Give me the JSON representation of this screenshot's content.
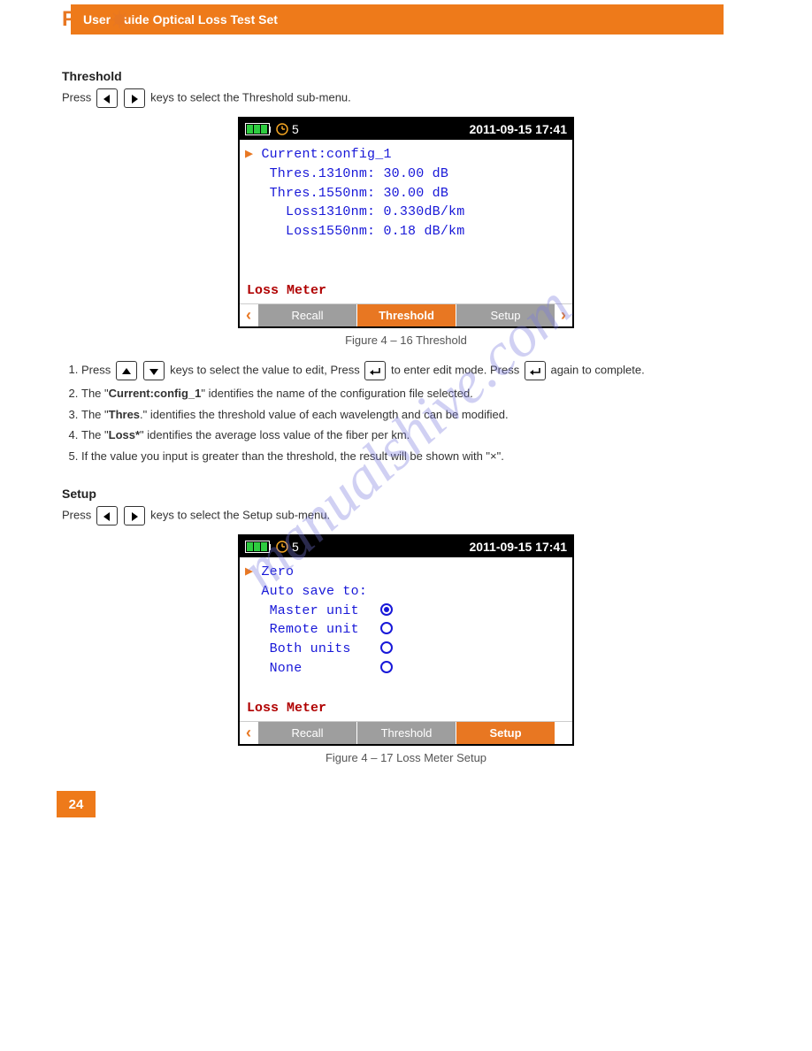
{
  "header": {
    "brand": "PRO",
    "band_text": "User Guide Optical Loss Test Set"
  },
  "watermark": "manualshive.com",
  "section_threshold": {
    "title": "Threshold",
    "intro_prefix": "Press",
    "intro_text": "keys to select the Threshold sub-menu.",
    "ds": {
      "timer": "5",
      "datetime": "2011-09-15 17:41",
      "lines": {
        "current": "Current:config_1",
        "thres1310_label": "Thres.1310nm:",
        "thres1310_value": "30.00 dB",
        "thres1550_label": "Thres.1550nm:",
        "thres1550_value": "30.00 dB",
        "loss1310_label": "Loss1310nm:",
        "loss1310_value": "0.330dB/km",
        "loss1550_label": "Loss1550nm:",
        "loss1550_value": "0.18 dB/km"
      },
      "footer": "Loss Meter",
      "tabs": {
        "recall": "Recall",
        "threshold": "Threshold",
        "setup": "Setup"
      }
    },
    "figcaption": "Figure 4 – 16 Threshold",
    "steps": {
      "s1_a": "Press",
      "s1_b": "keys to select the value to edit, Press",
      "s1_c": "to enter edit mode. Press",
      "s1_d": "again to complete.",
      "s2_a": "The \"",
      "s2_b": "Current:config_1",
      "s2_c": "\" identifies the name of the configuration file selected.",
      "s3_a": "The \"",
      "s3_b": "Thres",
      "s3_c": ".\" identifies the threshold value of each wavelength and can be modified.",
      "s4_a": "The \"",
      "s4_b": "Loss*",
      "s4_c": "\" identifies the average loss value of the fiber per km.",
      "s5": "If the value you input is greater than the threshold, the result will be shown with \"×\"."
    }
  },
  "section_setup": {
    "title": "Setup",
    "intro_prefix": "Press",
    "intro_text": "keys to select the Setup sub-menu.",
    "ds": {
      "timer": "5",
      "datetime": "2011-09-15 17:41",
      "lines": {
        "zero": "Zero",
        "auto_save": "Auto save to:",
        "opt1": "Master unit",
        "opt2": "Remote unit",
        "opt3": "Both units",
        "opt4": "None"
      },
      "footer": "Loss Meter",
      "tabs": {
        "recall": "Recall",
        "threshold": "Threshold",
        "setup": "Setup"
      }
    },
    "figcaption": "Figure 4 – 17 Loss Meter Setup"
  },
  "page_number": "24"
}
